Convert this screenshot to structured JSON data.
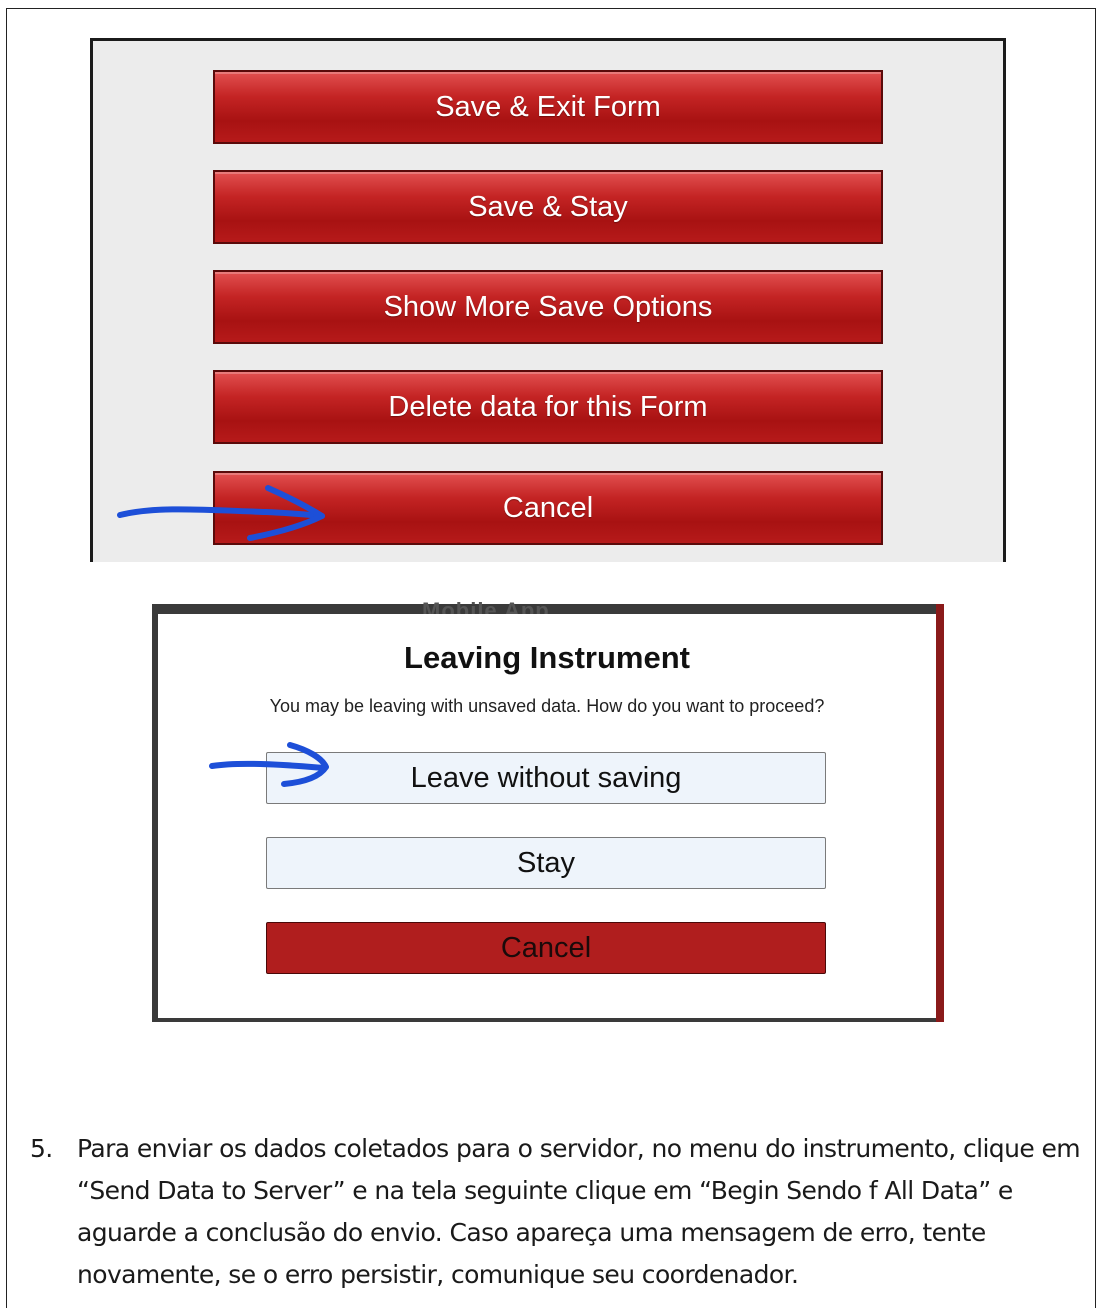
{
  "save_menu": {
    "buttons": [
      "Save & Exit Form",
      "Save & Stay",
      "Show More Save Options",
      "Delete data for this Form",
      "Cancel"
    ]
  },
  "dialog": {
    "background_title": "Mobile App",
    "title": "Leaving Instrument",
    "message": "You may be leaving with unsaved data. How do you want to proceed?",
    "leave_label": "Leave without saving",
    "stay_label": "Stay",
    "cancel_label": "Cancel"
  },
  "instruction": {
    "number": "5.",
    "text": "Para enviar os dados coletados para o servidor, no menu do instrumento, clique em “Send Data to Server” e na tela seguinte clique em “Begin Sendo f All Data” e aguarde a conclusão do envio. Caso apareça uma mensagem de erro, tente novamente, se o erro persistir, comunique seu coordenador."
  },
  "colors": {
    "red_button": "#c42424",
    "annotation_arrow": "#1d4fd8",
    "light_button": "#eef4fb"
  }
}
